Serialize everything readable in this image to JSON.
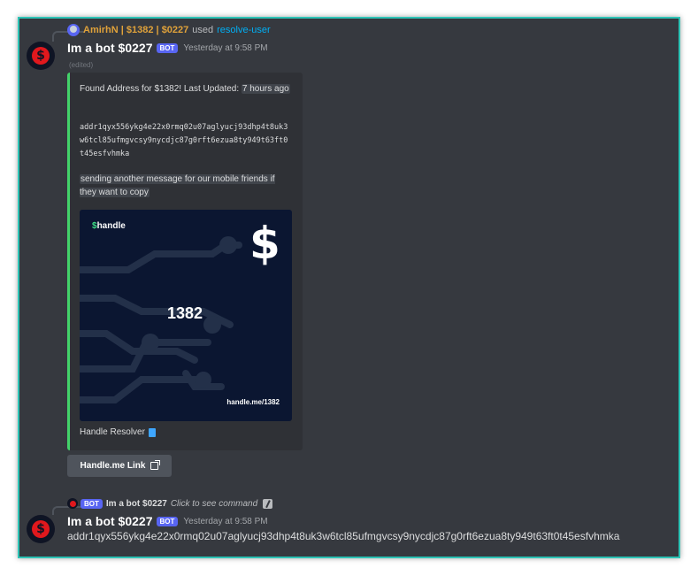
{
  "reply": {
    "user": "AmirhN | $1382 | $0227",
    "used_text": "used",
    "command": "resolve-user"
  },
  "message1": {
    "username": "Im a bot $0227",
    "bot_tag": "BOT",
    "timestamp": "Yesterday at 9:58 PM",
    "edited": "(edited)",
    "avatar_symbol": "$"
  },
  "embed": {
    "accent_color": "#43d36a",
    "line1_prefix": "Found Address for $1382! Last Updated:",
    "line1_highlight": "7 hours ago",
    "address_code": "addr1qyx556ykg4e22x0rmq02u07aglyucj93dhp4t8uk3w6tcl85ufmgvcsy9nycdjc87g0rft6ezua8ty949t63ft0t45esfvhmka",
    "mobile_note": "sending another message for our mobile friends if they want to copy",
    "image": {
      "logo_symbol": "$",
      "logo_text": "handle",
      "big_symbol": "$",
      "handle_number": "1382",
      "url": "handle.me/1382"
    },
    "footer": "Handle Resolver",
    "footer_icon": "book-icon"
  },
  "link_button": {
    "label": "Handle.me Link",
    "icon": "external-link-icon"
  },
  "command_line": {
    "bot_tag": "BOT",
    "name": "Im a bot $0227",
    "hint": "Click to see command"
  },
  "message2": {
    "username": "Im a bot $0227",
    "bot_tag": "BOT",
    "timestamp": "Yesterday at 9:58 PM",
    "content": "addr1qyx556ykg4e22x0rmq02u07aglyucj93dhp4t8uk3w6tcl85ufmgvcsy9nycdjc87g0rft6ezua8ty949t63ft0t45esfvhmka",
    "avatar_symbol": "$"
  },
  "colors": {
    "background": "#36393f",
    "frame_border": "#2ec4b6",
    "reply_user": "#e0a23a",
    "command_link": "#00aff4",
    "bot_tag": "#5865f2",
    "avatar_coin": "#e0181d",
    "card_bg": "#0b1631",
    "logo_dollar": "#3ddc84"
  }
}
